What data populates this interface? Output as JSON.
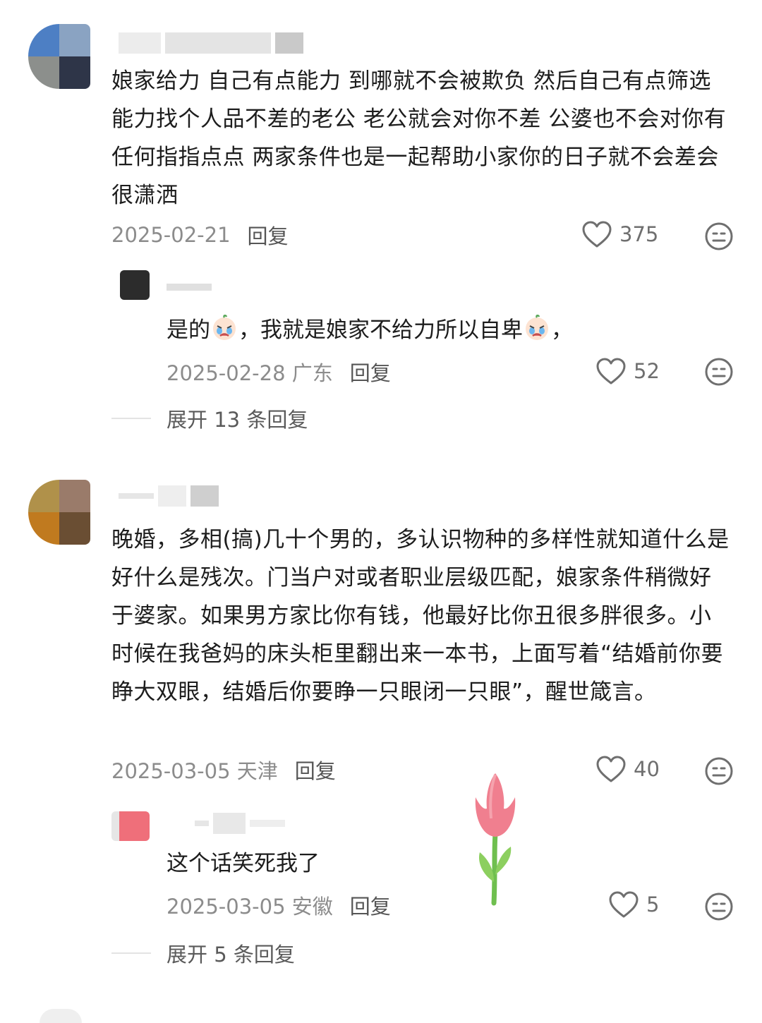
{
  "comments": [
    {
      "text": "娘家给力  自己有点能力  到哪就不会被欺负  然后自己有点筛选能力找个人品不差的老公  老公就会对你不差  公婆也不会对你有任何指指点点  两家条件也是一起帮助小家你的日子就不会差会很潇洒",
      "date": "2025-02-21",
      "location": "",
      "reply_label": "回复",
      "likes": "375",
      "reply": {
        "text_a": "是的",
        "text_b": "，我就是娘家不给力所以自卑",
        "text_c": "，",
        "date": "2025-02-28",
        "location": "广东",
        "reply_label": "回复",
        "likes": "52"
      },
      "expand_label": "展开 13 条回复"
    },
    {
      "text": "晚婚，多相(搞)几十个男的，多认识物种的多样性就知道什么是好什么是残次。门当户对或者职业层级匹配，娘家条件稍微好于婆家。如果男方家比你有钱，他最好比你丑很多胖很多。小时候在我爸妈的床头柜里翻出来一本书，上面写着“结婚前你要睁大双眼，结婚后你要睁一只眼闭一只眼”，醒世箴言。",
      "date": "2025-03-05",
      "location": "天津",
      "reply_label": "回复",
      "likes": "40",
      "reply": {
        "text": "这个话笑死我了",
        "date": "2025-03-05",
        "location": "安徽",
        "reply_label": "回复",
        "likes": "5"
      },
      "expand_label": "展开 5 条回复"
    }
  ],
  "colors": {
    "text": "#1d1d1d",
    "meta": "#8c8c8c",
    "icon": "#6f6f6f",
    "tulip_pink": "#f07f8f",
    "tulip_green": "#6fbf4f"
  }
}
